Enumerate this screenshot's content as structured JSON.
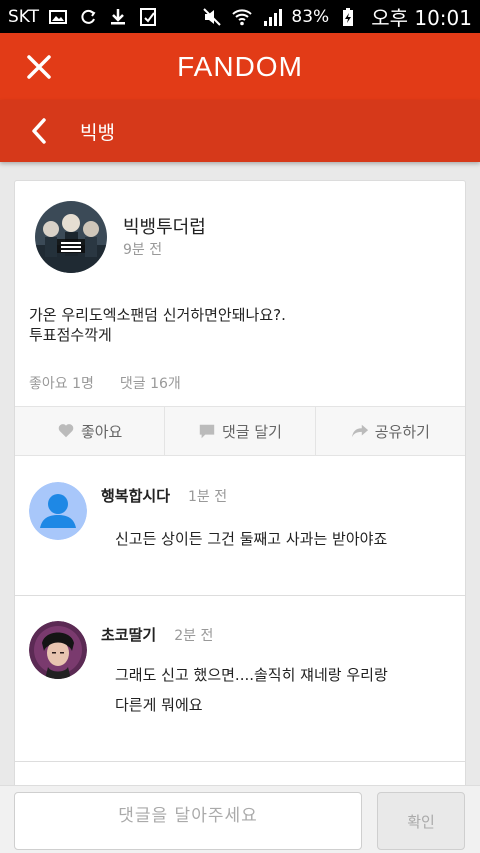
{
  "status_bar": {
    "carrier": "SKT",
    "battery_percent": "83%",
    "time": "오후 10:01",
    "icons": [
      "image-icon",
      "sync-icon",
      "download-icon",
      "task-icon",
      "mute-icon",
      "wifi-icon",
      "signal-icon",
      "battery-charging-icon"
    ]
  },
  "header": {
    "app_title": "FANDOM",
    "community_name": "빅뱅"
  },
  "post": {
    "author": "빅뱅투더럽",
    "time": "9분 전",
    "body_line1": "가온 우리도엑소팬덤 신거하면안돼나요?.",
    "body_line2": "투표점수깍게",
    "likes": "좋아요 1명",
    "comments_count": "댓글 16개"
  },
  "actions": {
    "like_label": "좋아요",
    "comment_label": "댓글 달기",
    "share_label": "공유하기"
  },
  "comments": [
    {
      "name": "행복합시다",
      "time": "1분 전",
      "text": "신고든 상이든 그건 둘째고 사과는 받아야죠"
    },
    {
      "name": "초코딸기",
      "time": "2분 전",
      "text_line1": "그래도 신고 했으면....솔직히 쟤네랑 우리랑",
      "text_line2": "다른게 뭐에요"
    }
  ],
  "composer": {
    "placeholder": "댓글을  달아주세요",
    "confirm_label": "확인"
  },
  "colors": {
    "header_primary": "#e23b17",
    "header_secondary": "#d6391a",
    "accent_avatar": "#1e88e5"
  }
}
